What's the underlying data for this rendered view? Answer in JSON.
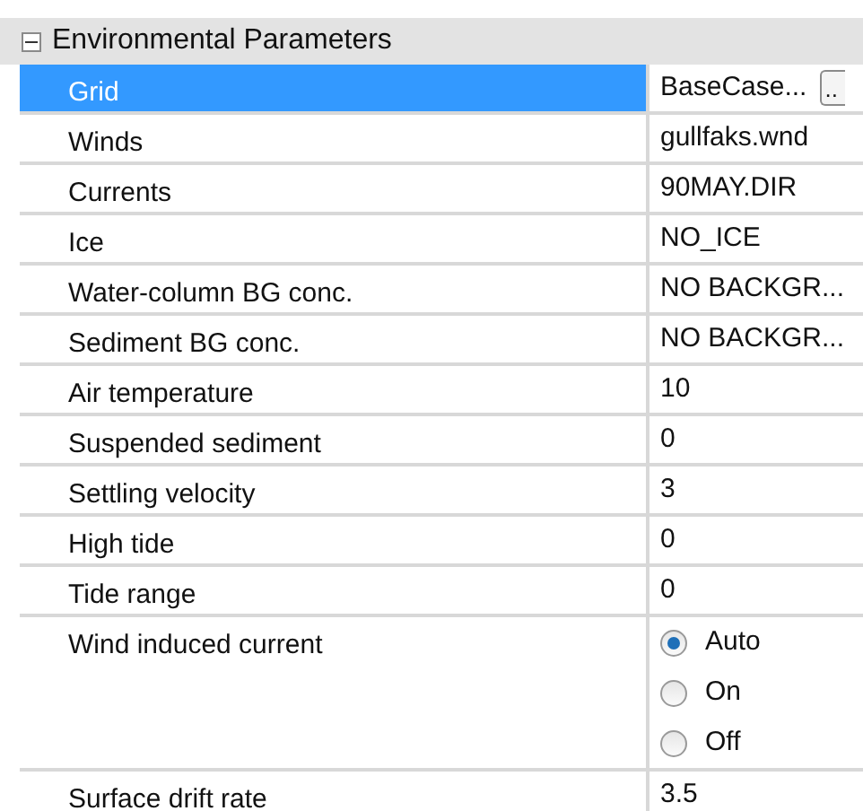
{
  "category": {
    "title": "Environmental Parameters",
    "expanded": true
  },
  "rows": [
    {
      "kind": "text",
      "label": "Grid",
      "value": "BaseCase...",
      "selected": true,
      "button": ".."
    },
    {
      "kind": "text",
      "label": "Winds",
      "value": "gullfaks.wnd",
      "selected": false
    },
    {
      "kind": "text",
      "label": "Currents",
      "value": "90MAY.DIR",
      "selected": false
    },
    {
      "kind": "text",
      "label": "Ice",
      "value": "NO_ICE",
      "selected": false
    },
    {
      "kind": "text",
      "label": "Water-column BG conc.",
      "value": "NO BACKGR...",
      "selected": false
    },
    {
      "kind": "text",
      "label": "Sediment BG conc.",
      "value": "NO BACKGR...",
      "selected": false
    },
    {
      "kind": "text",
      "label": "Air temperature",
      "value": "10",
      "selected": false
    },
    {
      "kind": "text",
      "label": "Suspended sediment",
      "value": "0",
      "selected": false
    },
    {
      "kind": "text",
      "label": "Settling velocity",
      "value": "3",
      "selected": false
    },
    {
      "kind": "text",
      "label": "High tide",
      "value": "0",
      "selected": false
    },
    {
      "kind": "text",
      "label": "Tide range",
      "value": "0",
      "selected": false
    },
    {
      "kind": "radio",
      "label": "Wind induced current",
      "selected": false,
      "options": [
        {
          "label": "Auto",
          "selected": true
        },
        {
          "label": "On",
          "selected": false
        },
        {
          "label": "Off",
          "selected": false
        }
      ]
    },
    {
      "kind": "text",
      "label": "Surface drift rate",
      "value": "3.5",
      "selected": false
    }
  ]
}
